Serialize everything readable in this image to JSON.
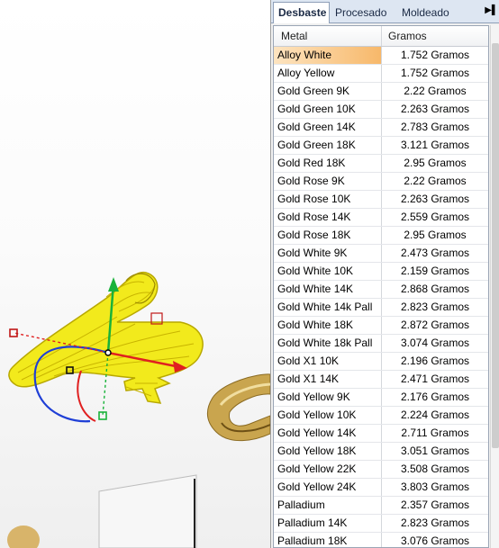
{
  "tabs": [
    {
      "label": "Desbaste",
      "active": true
    },
    {
      "label": "Procesado",
      "active": false
    },
    {
      "label": "Moldeado",
      "active": false
    }
  ],
  "tab_scroll_icon": "arrow-right-icon",
  "table": {
    "columns": [
      "Metal",
      "Gramos"
    ],
    "selected_index": 0,
    "rows": [
      {
        "metal": "Alloy White",
        "gramos": "1.752 Gramos"
      },
      {
        "metal": "Alloy Yellow",
        "gramos": "1.752 Gramos"
      },
      {
        "metal": "Gold Green 9K",
        "gramos": "2.22 Gramos"
      },
      {
        "metal": "Gold Green 10K",
        "gramos": "2.263 Gramos"
      },
      {
        "metal": "Gold Green 14K",
        "gramos": "2.783 Gramos"
      },
      {
        "metal": "Gold Green 18K",
        "gramos": "3.121 Gramos"
      },
      {
        "metal": "Gold Red 18K",
        "gramos": "2.95 Gramos"
      },
      {
        "metal": "Gold Rose 9K",
        "gramos": "2.22 Gramos"
      },
      {
        "metal": "Gold Rose 10K",
        "gramos": "2.263 Gramos"
      },
      {
        "metal": "Gold Rose 14K",
        "gramos": "2.559 Gramos"
      },
      {
        "metal": "Gold Rose 18K",
        "gramos": "2.95 Gramos"
      },
      {
        "metal": "Gold White 9K",
        "gramos": "2.473 Gramos"
      },
      {
        "metal": "Gold White 10K",
        "gramos": "2.159 Gramos"
      },
      {
        "metal": "Gold White 14K",
        "gramos": "2.868 Gramos"
      },
      {
        "metal": "Gold White 14k Pall",
        "gramos": "2.823 Gramos"
      },
      {
        "metal": "Gold White 18K",
        "gramos": "2.872 Gramos"
      },
      {
        "metal": "Gold White 18k Pall",
        "gramos": "3.074 Gramos"
      },
      {
        "metal": "Gold X1 10K",
        "gramos": "2.196 Gramos"
      },
      {
        "metal": "Gold X1 14K",
        "gramos": "2.471 Gramos"
      },
      {
        "metal": "Gold Yellow 9K",
        "gramos": "2.176 Gramos"
      },
      {
        "metal": "Gold Yellow 10K",
        "gramos": "2.224 Gramos"
      },
      {
        "metal": "Gold Yellow 14K",
        "gramos": "2.711 Gramos"
      },
      {
        "metal": "Gold Yellow 18K",
        "gramos": "3.051 Gramos"
      },
      {
        "metal": "Gold Yellow 22K",
        "gramos": "3.508 Gramos"
      },
      {
        "metal": "Gold Yellow 24K",
        "gramos": "3.803 Gramos"
      },
      {
        "metal": "Palladium",
        "gramos": "2.357 Gramos"
      },
      {
        "metal": "Palladium 14K",
        "gramos": "2.823 Gramos"
      },
      {
        "metal": "Palladium 18K",
        "gramos": "3.076 Gramos"
      }
    ]
  },
  "colors": {
    "selection": "#f7b86a",
    "model_wireframe": "#f2ea1c",
    "axis_x": "#e02020",
    "axis_y": "#19b23a",
    "axis_z": "#1f3fd6",
    "ring_gold": "#c9a54e"
  }
}
